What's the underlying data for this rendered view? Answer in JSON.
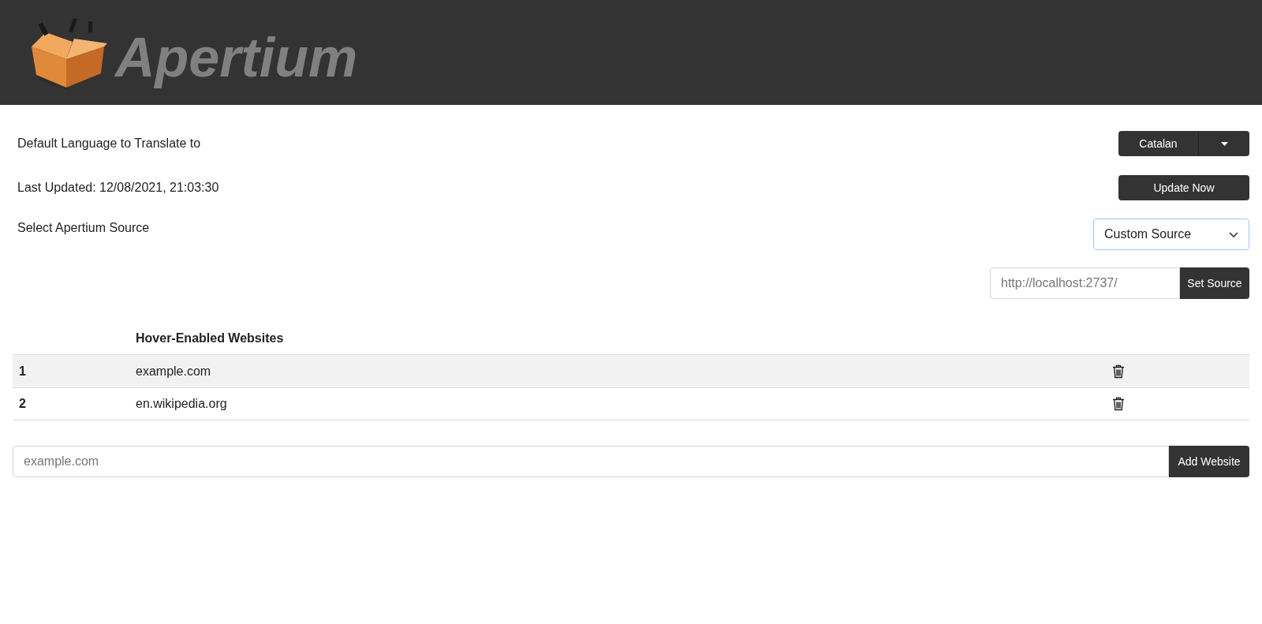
{
  "header": {
    "logo_text": "Apertium"
  },
  "settings": {
    "language_label": "Default Language to Translate to",
    "language": "Catalan",
    "last_updated": "Last Updated: 12/08/2021, 21:03:30",
    "update_button": "Update Now",
    "source_label": "Select Apertium Source",
    "source": "Custom Source",
    "source_url_placeholder": "http://localhost:2737/",
    "set_source_button": "Set Source"
  },
  "table": {
    "columns": [
      "Hover-Enabled Websites"
    ],
    "rows": [
      {
        "index": "1",
        "site": "example.com"
      },
      {
        "index": "2",
        "site": "en.wikipedia.org"
      }
    ]
  },
  "add": {
    "placeholder": "example.com",
    "button": "Add Website"
  }
}
